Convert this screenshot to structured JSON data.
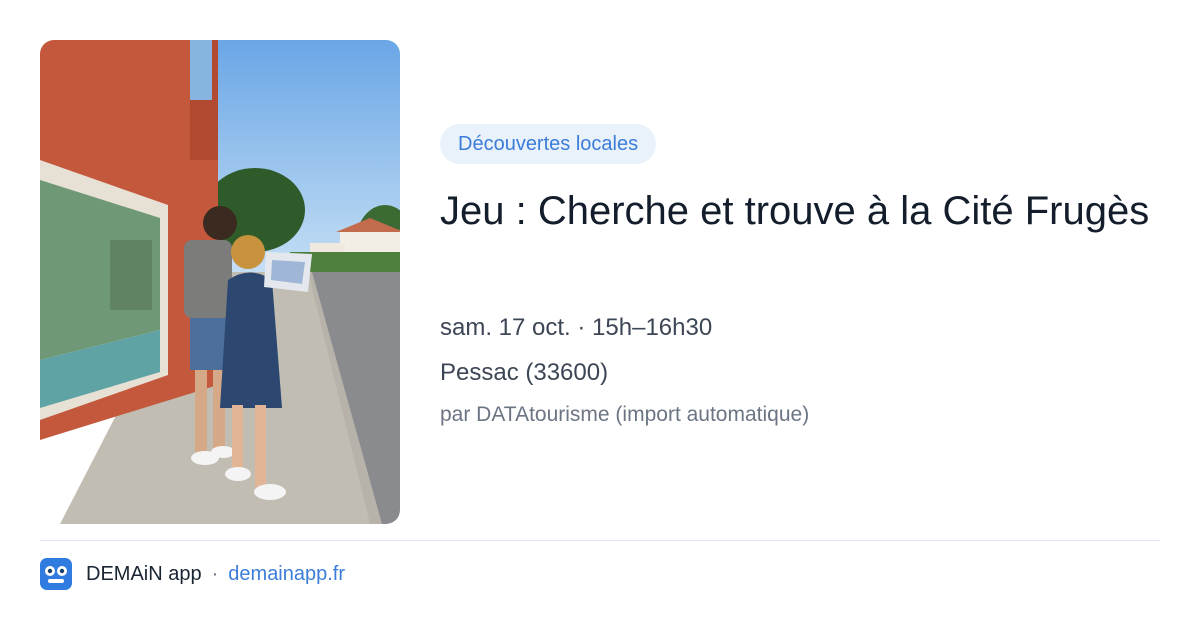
{
  "event": {
    "category": "Découvertes locales",
    "title": "Jeu : Cherche et trouve à la Cité Frugès",
    "date_time": "sam. 17 oct. · 15h–16h30",
    "location": "Pessac (33600)",
    "source": "par DATAtourisme (import automatique)"
  },
  "photo": {
    "icon": "event-photo",
    "wall_color": "#c4583c",
    "sky_color": "#8fc0ea"
  },
  "footer": {
    "app_name": "DEMAiN app",
    "separator": "·",
    "url": "demainapp.fr",
    "app_icon": "demain-app-icon"
  },
  "colors": {
    "accent": "#3b7dd8",
    "badge_bg": "#e9f1fb",
    "title": "#141d2b",
    "muted": "#6b7583"
  }
}
